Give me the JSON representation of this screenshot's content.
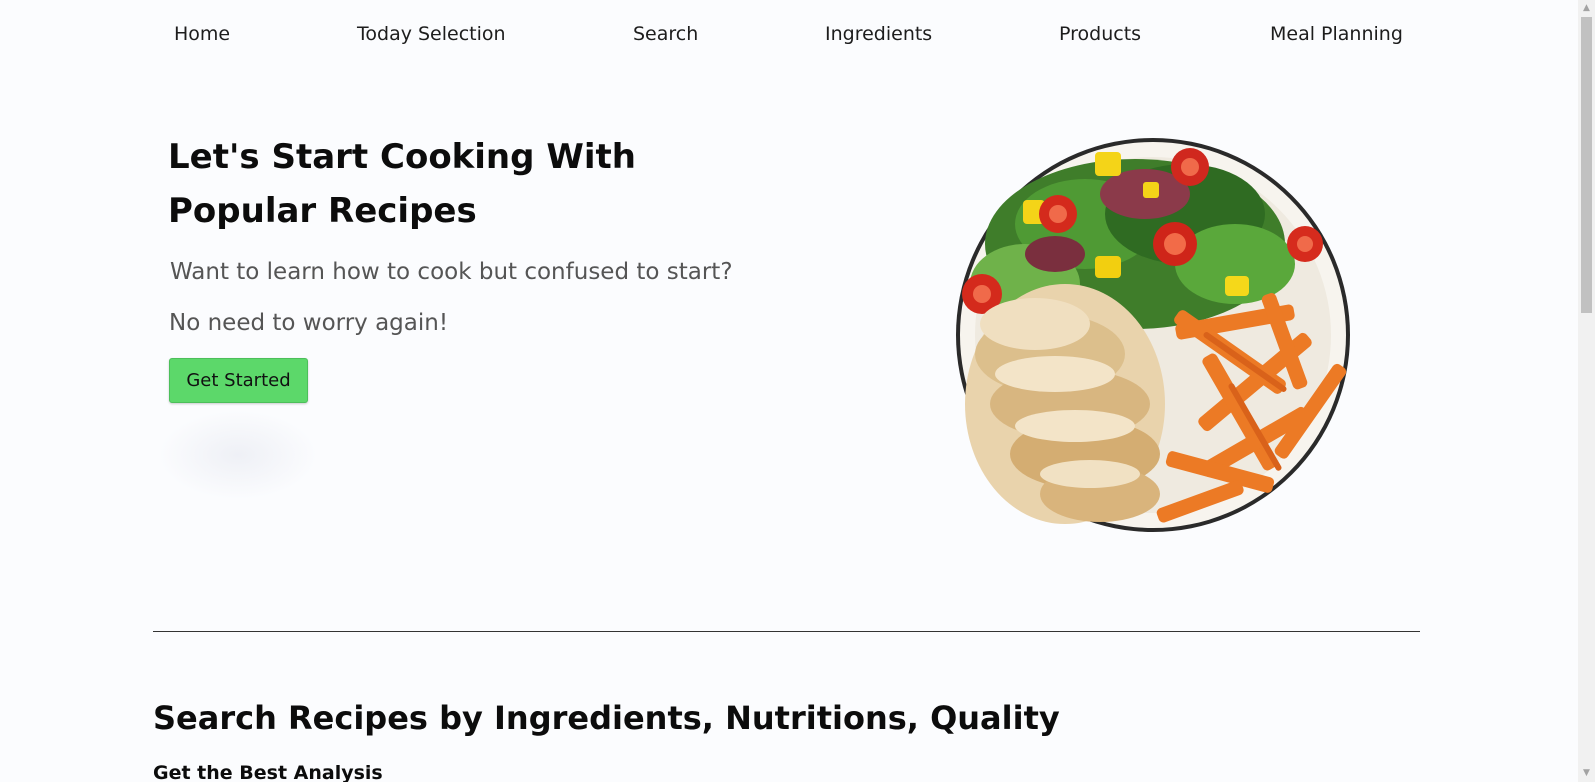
{
  "nav": {
    "items": [
      {
        "label": "Home"
      },
      {
        "label": "Today Selection"
      },
      {
        "label": "Search"
      },
      {
        "label": "Ingredients"
      },
      {
        "label": "Products"
      },
      {
        "label": "Meal Planning"
      }
    ]
  },
  "hero": {
    "title": "Let's Start Cooking With Popular Recipes",
    "subtitle": "Want to learn how to cook but confused to start?",
    "subtitle2": "No need to worry again!",
    "cta_label": "Get Started",
    "image_icon": "food-plate-image"
  },
  "section": {
    "title": "Search Recipes by Ingredients, Nutritions, Quality",
    "subtitle": "Get the Best Analysis"
  },
  "scrollbar": {
    "up_arrow": "▲",
    "down_arrow": "▼"
  },
  "colors": {
    "background": "#fbfcfe",
    "cta": "#5cd86a",
    "text": "#0c0c0c"
  }
}
